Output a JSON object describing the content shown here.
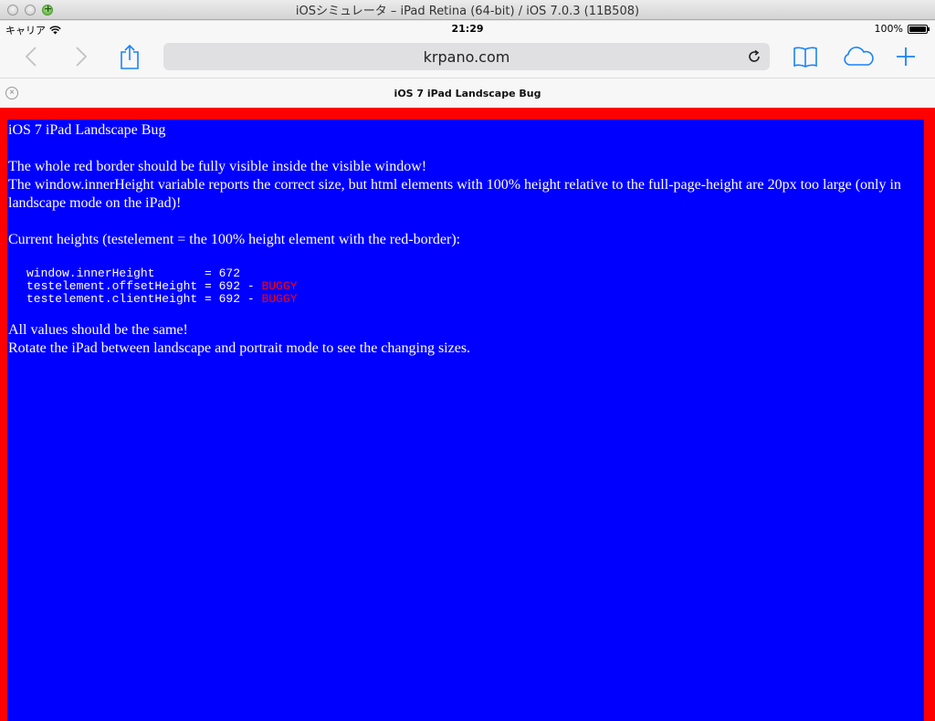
{
  "window": {
    "title": "iOSシミュレータ – iPad Retina (64-bit) / iOS 7.0.3 (11B508)"
  },
  "status_bar": {
    "carrier": "キャリア",
    "time": "21:29",
    "battery_percent": "100%"
  },
  "toolbar": {
    "url": "krpano.com",
    "icons": [
      "back-icon",
      "forward-icon",
      "share-icon",
      "reload-icon",
      "bookmarks-icon",
      "icloud-tabs-icon",
      "new-tab-icon"
    ]
  },
  "tab": {
    "title": "iOS 7 iPad Landscape Bug"
  },
  "page": {
    "heading": "iOS 7 iPad Landscape Bug",
    "line1": "The whole red border should be fully visible inside the visible window!",
    "line2": "The window.innerHeight variable reports the correct size, but html elements with 100% height relative to the full-page-height are 20px too large (only in landscape mode on the iPad)!",
    "current_heights": "Current heights (testelement = the 100% height element with the red-border):",
    "rows": [
      {
        "label": "window.innerHeight       = 672",
        "flag": ""
      },
      {
        "label": "testelement.offsetHeight = 692 - ",
        "flag": "BUGGY"
      },
      {
        "label": "testelement.clientHeight = 692 - ",
        "flag": "BUGGY"
      }
    ],
    "footer1": "All values should be the same!",
    "footer2": "Rotate the iPad between landscape and portrait mode to see the changing sizes."
  },
  "colors": {
    "border": "#ff0000",
    "background": "#0000ff",
    "text": "#ffffff",
    "buggy": "#ff0000",
    "ios_tint": "#1a82fb"
  }
}
